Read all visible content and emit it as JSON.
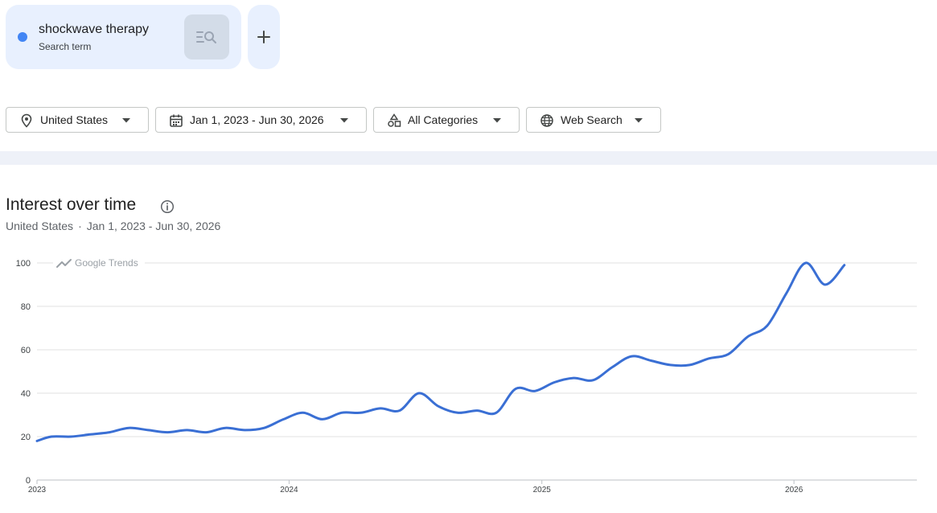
{
  "search_term": {
    "name": "shockwave therapy",
    "type_label": "Search term",
    "color": "#4285f4"
  },
  "filters": {
    "location": "United States",
    "date_range": "Jan 1, 2023 - Jun 30, 2026",
    "category": "All Categories",
    "search_type": "Web Search"
  },
  "section": {
    "title": "Interest over time",
    "subtitle_location": "United States",
    "subtitle_separator": "·",
    "subtitle_range": "Jan 1, 2023 - Jun 30, 2026"
  },
  "chart_data": {
    "type": "line",
    "watermark": "Google Trends",
    "ylim": [
      0,
      100
    ],
    "yticks": [
      0,
      20,
      40,
      60,
      80,
      100
    ],
    "xticks": [
      "2023",
      "2024",
      "2025",
      "2026"
    ],
    "x": [
      "2023-01-01",
      "2023-01-22",
      "2023-02-19",
      "2023-03-19",
      "2023-04-16",
      "2023-05-14",
      "2023-06-11",
      "2023-07-09",
      "2023-08-06",
      "2023-09-03",
      "2023-10-01",
      "2023-10-29",
      "2023-11-26",
      "2023-12-24",
      "2024-01-21",
      "2024-02-18",
      "2024-03-17",
      "2024-04-14",
      "2024-05-12",
      "2024-06-09",
      "2024-07-07",
      "2024-08-04",
      "2024-09-01",
      "2024-09-29",
      "2024-10-27",
      "2024-11-24",
      "2024-12-22",
      "2025-01-19",
      "2025-02-16",
      "2025-03-16",
      "2025-04-13",
      "2025-05-11",
      "2025-06-08",
      "2025-07-06",
      "2025-08-03",
      "2025-08-31",
      "2025-09-28",
      "2025-10-26",
      "2025-11-23",
      "2025-12-21",
      "2026-01-18",
      "2026-02-15",
      "2026-03-15",
      "2026-04-12",
      "2026-05-10",
      "2026-06-07",
      "2026-06-28"
    ],
    "series": [
      {
        "color": "#3a6fd4",
        "values": [
          18,
          20,
          20,
          21,
          22,
          24,
          23,
          22,
          23,
          22,
          24,
          23,
          24,
          28,
          31,
          28,
          31,
          31,
          33,
          32,
          40,
          34,
          31,
          32,
          31,
          42,
          41,
          45,
          47,
          46,
          52,
          57,
          55,
          53,
          53,
          56,
          58,
          66,
          71,
          86,
          100,
          90,
          99
        ]
      }
    ]
  }
}
